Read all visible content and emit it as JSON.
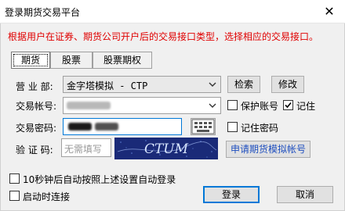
{
  "window": {
    "title": "登录期货交易平台",
    "close_glyph": "✕"
  },
  "notice": "根据用户在证券、期货公司开户后的交易接口类型，选择相应的交易接口。",
  "tabs": [
    {
      "label": "期货",
      "active": true
    },
    {
      "label": "股票",
      "active": false
    },
    {
      "label": "股票期权",
      "active": false
    }
  ],
  "form": {
    "broker_label": "营 业 部:",
    "broker_value": "金字塔模拟 - CTP",
    "search_button": "检索",
    "modify_button": "修改",
    "account_label": "交易帐号:",
    "password_label": "交易密码:",
    "captcha_label": "验 证 码:",
    "captcha_placeholder": "无需填写",
    "captcha_text": "CTUM",
    "protect_account_label": "保护账号",
    "protect_account_checked": false,
    "remember_label": "记住",
    "remember_checked": true,
    "remember_password_label": "记住密码",
    "remember_password_checked": false,
    "apply_sim_account": "申请期货模拟帐号"
  },
  "footer": {
    "auto_login_label": "10秒钟后自动按照上述设置自动登录",
    "auto_login_checked": false,
    "connect_on_start_label": "启动时连接",
    "connect_on_start_checked": false,
    "login_button": "登录",
    "cancel_button": "取消"
  },
  "colors": {
    "notice": "#e00000",
    "captcha_bg": "#1a2a78",
    "captcha_text": "#d8e6ff",
    "accent": "#0078d7"
  },
  "icons": [
    "close-icon",
    "chevron-down-icon",
    "check-icon",
    "keyboard-icon"
  ]
}
